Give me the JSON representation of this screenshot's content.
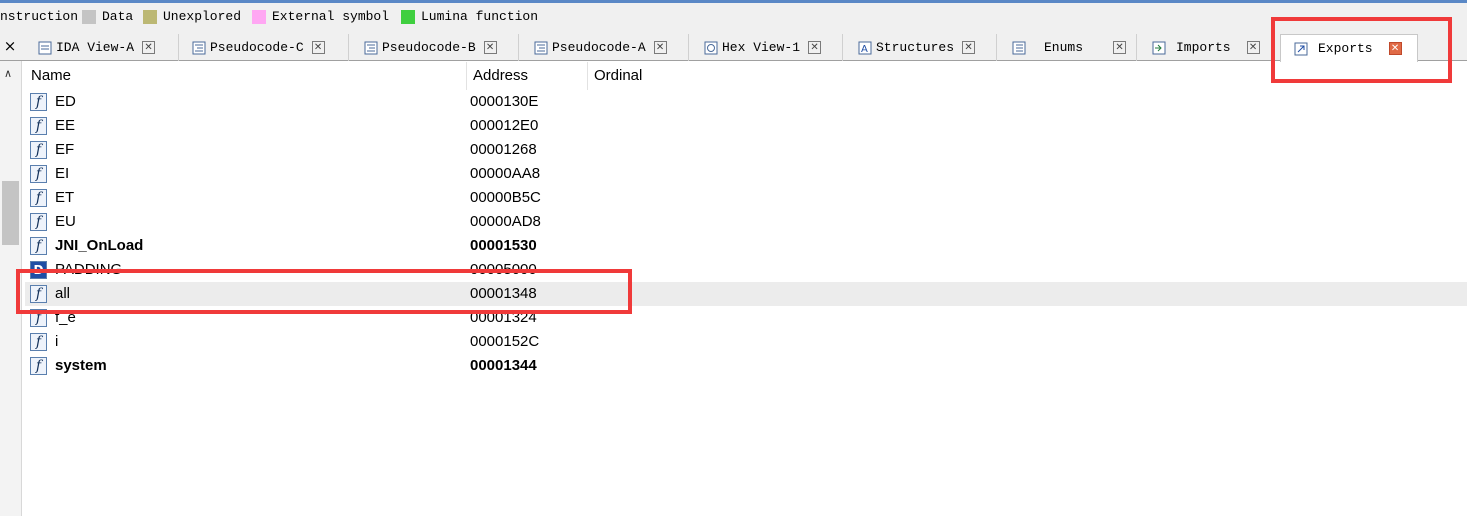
{
  "legend": {
    "items": [
      {
        "label": "nstruction",
        "color": ""
      },
      {
        "label": "Data",
        "color": "#c4c4c4"
      },
      {
        "label": "Unexplored",
        "color": "#bcb874"
      },
      {
        "label": "External symbol",
        "color": "#ffa7f3"
      },
      {
        "label": "Lumina function",
        "color": "#3fcf3f"
      }
    ]
  },
  "tabs": [
    {
      "label": "IDA View-A",
      "icon": "ida-view-icon"
    },
    {
      "label": "Pseudocode-C",
      "icon": "pseudocode-icon"
    },
    {
      "label": "Pseudocode-B",
      "icon": "pseudocode-icon"
    },
    {
      "label": "Pseudocode-A",
      "icon": "pseudocode-icon"
    },
    {
      "label": "Hex View-1",
      "icon": "hex-view-icon"
    },
    {
      "label": "Structures",
      "icon": "structures-icon"
    },
    {
      "label": "Enums",
      "icon": "enums-icon"
    },
    {
      "label": "Imports",
      "icon": "imports-icon"
    },
    {
      "label": "Exports",
      "icon": "exports-icon",
      "active": true
    }
  ],
  "gutter": {
    "close_all": "×",
    "scroll_up": "∧"
  },
  "table": {
    "columns": [
      "Name",
      "Address",
      "Ordinal"
    ],
    "rows": [
      {
        "name": "ED",
        "address": "0000130E",
        "bold": false,
        "icon": "function-icon"
      },
      {
        "name": "EE",
        "address": "000012E0",
        "bold": false,
        "icon": "function-icon"
      },
      {
        "name": "EF",
        "address": "00001268",
        "bold": false,
        "icon": "function-icon"
      },
      {
        "name": "EI",
        "address": "00000AA8",
        "bold": false,
        "icon": "function-icon"
      },
      {
        "name": "ET",
        "address": "00000B5C",
        "bold": false,
        "icon": "function-icon"
      },
      {
        "name": "EU",
        "address": "00000AD8",
        "bold": false,
        "icon": "function-icon"
      },
      {
        "name": "JNI_OnLoad",
        "address": "00001530",
        "bold": true,
        "icon": "function-icon"
      },
      {
        "name": "PADDING",
        "address": "00005000",
        "bold": false,
        "icon": "data-icon"
      },
      {
        "name": "all",
        "address": "00001348",
        "bold": false,
        "icon": "function-icon",
        "selected": true
      },
      {
        "name": "f_e",
        "address": "00001324",
        "bold": false,
        "icon": "function-icon"
      },
      {
        "name": "i",
        "address": "0000152C",
        "bold": false,
        "icon": "function-icon"
      },
      {
        "name": "system",
        "address": "00001344",
        "bold": true,
        "icon": "function-icon"
      }
    ]
  },
  "icons": {
    "function_glyph": "f",
    "data_glyph": "D"
  },
  "colors": {
    "highlight": "#f03a3a",
    "close_active": "#e06a46"
  }
}
